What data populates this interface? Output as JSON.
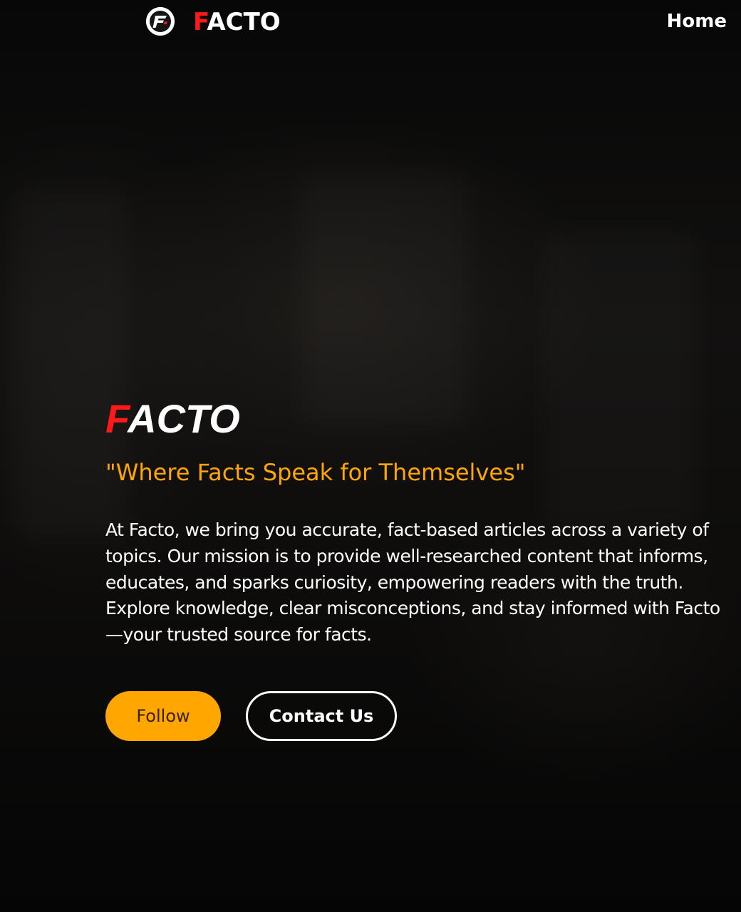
{
  "nav": {
    "logo_first_letter": "F",
    "logo_rest": "ACTO",
    "home_label": "Home"
  },
  "hero": {
    "title_first_letter": "F",
    "title_rest": "ACTO",
    "tagline": "\"Where Facts Speak for Themselves\"",
    "description_lines": [
      "At Facto, we bring you accurate, fact-based articles across a variety of",
      "topics. Our mission is to provide well-researched content that informs,",
      "educates, and sparks curiosity, empowering readers with the truth.",
      "Explore knowledge, clear misconceptions, and stay informed with Facto",
      "—your trusted source for facts."
    ],
    "follow_label": "Follow",
    "contact_label": "Contact Us"
  },
  "colors": {
    "accent": "#ffa600",
    "brand_red": "#ff1a1a",
    "background": "#0b0b0b",
    "text": "#ffffff"
  },
  "icons": {
    "logo": "facto-logo-icon"
  }
}
